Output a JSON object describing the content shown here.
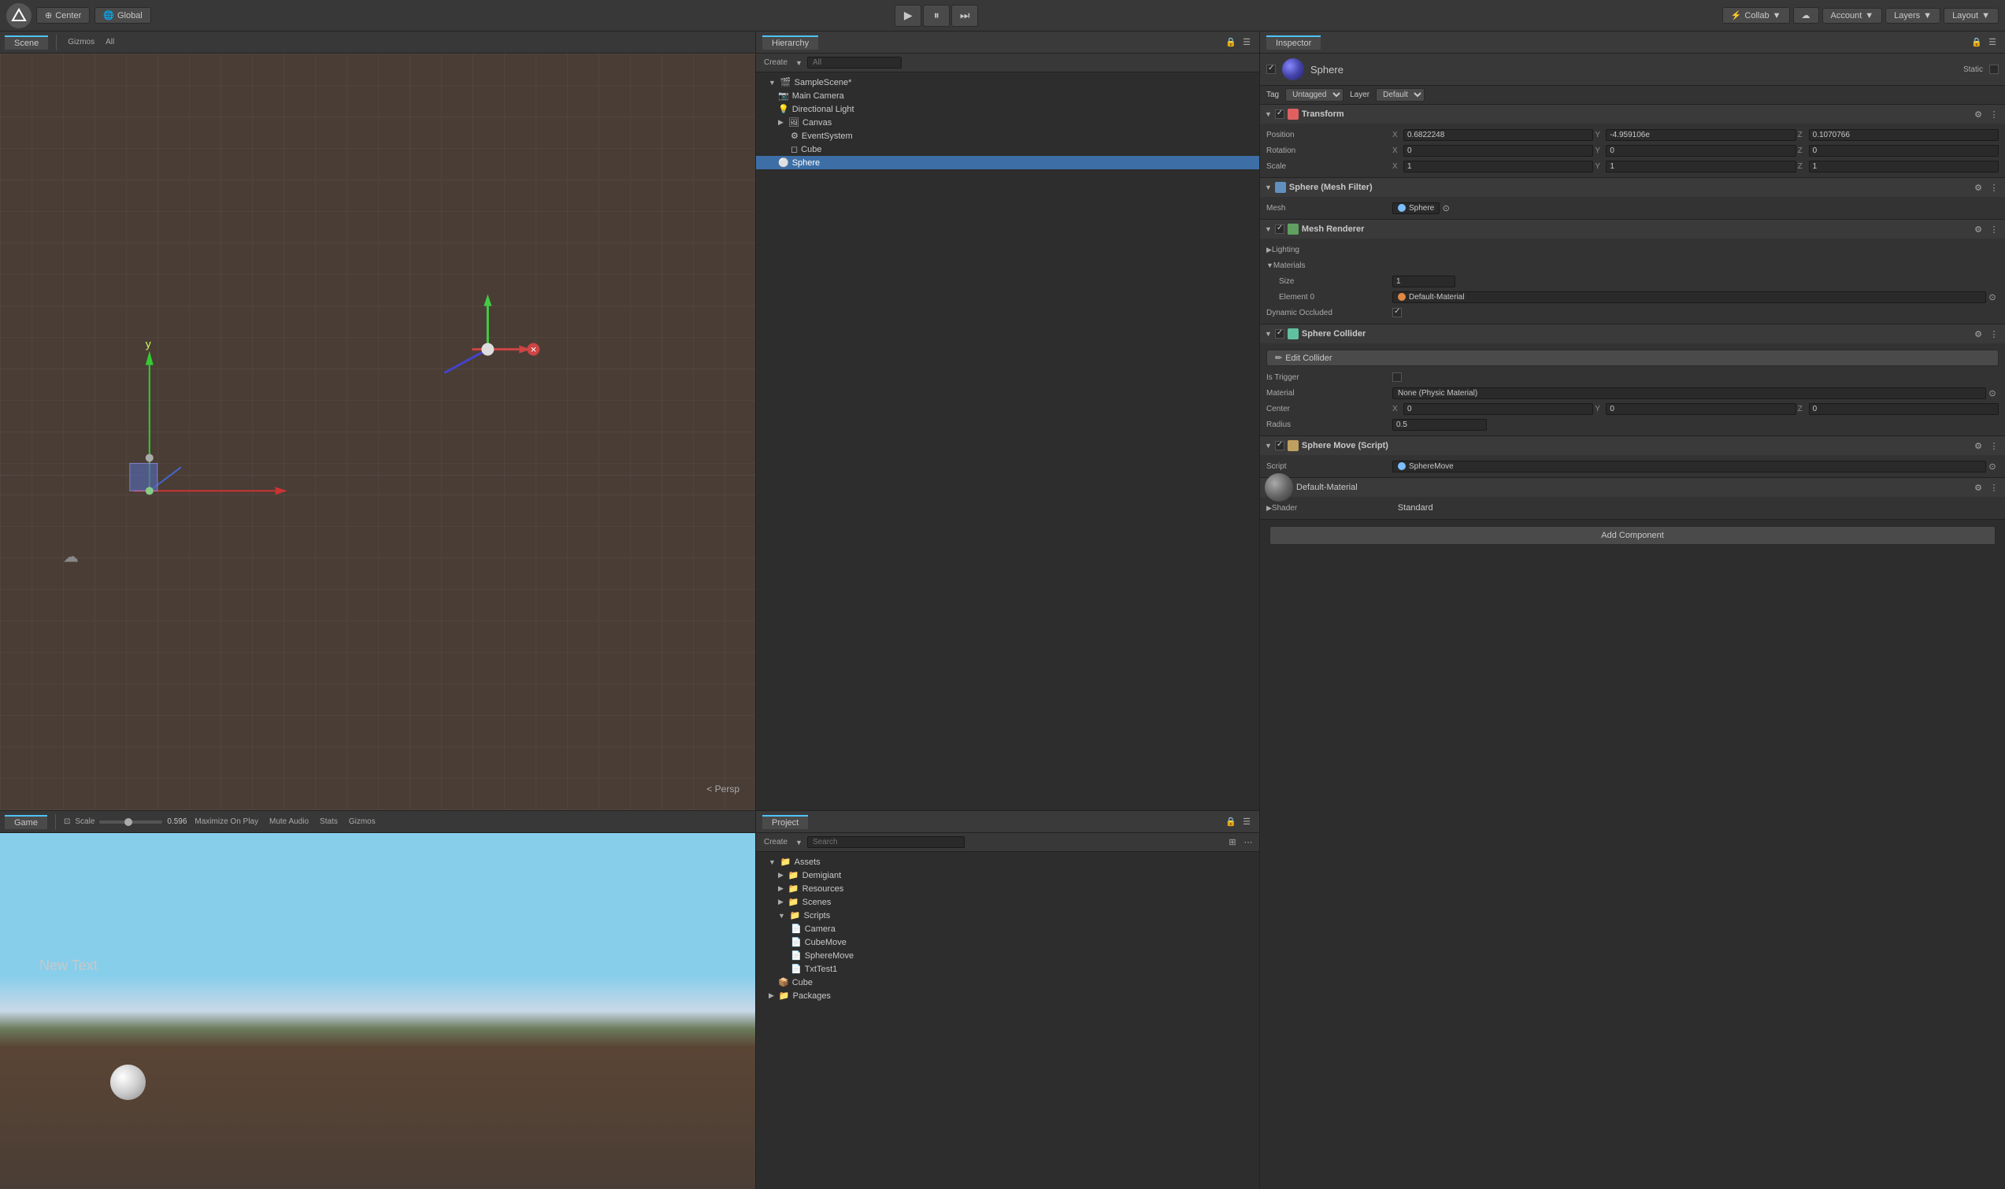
{
  "toolbar": {
    "logo": "U",
    "transform_center": "Center",
    "transform_global": "Global",
    "play": "▶",
    "pause": "⏸",
    "step": "⏭",
    "collab": "Collab",
    "cloud_icon": "☁",
    "account": "Account",
    "layers": "Layers",
    "layout": "Layout"
  },
  "scene": {
    "tab_label": "Scene",
    "gizmos": "Gizmos",
    "all_filter": "All",
    "persp_label": "< Persp"
  },
  "game": {
    "scale_label": "Scale",
    "scale_value": "0.596",
    "maximize_on_play": "Maximize On Play",
    "mute_audio": "Mute Audio",
    "stats": "Stats",
    "gizmos": "Gizmos",
    "new_text": "New Text"
  },
  "hierarchy": {
    "tab_label": "Hierarchy",
    "create_label": "Create",
    "all_label": "All",
    "scene_name": "SampleScene*",
    "items": [
      {
        "name": "Main Camera",
        "indent": 1,
        "type": "camera"
      },
      {
        "name": "Directional Light",
        "indent": 1,
        "type": "light"
      },
      {
        "name": "Canvas",
        "indent": 1,
        "type": "canvas"
      },
      {
        "name": "EventSystem",
        "indent": 2,
        "type": "go"
      },
      {
        "name": "Cube",
        "indent": 2,
        "type": "go"
      },
      {
        "name": "Sphere",
        "indent": 1,
        "type": "go",
        "selected": true
      }
    ]
  },
  "project": {
    "tab_label": "Project",
    "create_label": "Create",
    "search_placeholder": "Search",
    "items": [
      {
        "name": "Assets",
        "indent": 0,
        "type": "folder",
        "expanded": true
      },
      {
        "name": "Demigiant",
        "indent": 1,
        "type": "folder"
      },
      {
        "name": "Resources",
        "indent": 1,
        "type": "folder"
      },
      {
        "name": "Scenes",
        "indent": 1,
        "type": "folder"
      },
      {
        "name": "Scripts",
        "indent": 1,
        "type": "folder",
        "expanded": true
      },
      {
        "name": "Camera",
        "indent": 2,
        "type": "folder"
      },
      {
        "name": "CubeMove",
        "indent": 2,
        "type": "folder"
      },
      {
        "name": "SphereMove",
        "indent": 2,
        "type": "folder"
      },
      {
        "name": "TxtTest1",
        "indent": 2,
        "type": "folder"
      },
      {
        "name": "Cube",
        "indent": 1,
        "type": "script"
      },
      {
        "name": "Packages",
        "indent": 0,
        "type": "folder"
      }
    ]
  },
  "inspector": {
    "tab_label": "Inspector",
    "object_name": "Sphere",
    "static_label": "Static",
    "tag": "Untagged",
    "layer": "Default",
    "transform": {
      "title": "Transform",
      "position": {
        "x": "0.6822248",
        "y": "-4.959106e",
        "z": "0.1070766"
      },
      "rotation": {
        "x": "0",
        "y": "0",
        "z": "0"
      },
      "scale": {
        "x": "1",
        "y": "1",
        "z": "1"
      }
    },
    "mesh_filter": {
      "title": "Sphere (Mesh Filter)",
      "mesh": "Sphere"
    },
    "mesh_renderer": {
      "title": "Mesh Renderer",
      "lighting_label": "Lighting",
      "materials_label": "Materials",
      "size": "1",
      "element0": "Default-Material",
      "dynamic_occluded": "Dynamic Occluded"
    },
    "sphere_collider": {
      "title": "Sphere Collider",
      "edit_collider": "Edit Collider",
      "is_trigger_label": "Is Trigger",
      "material_label": "Material",
      "material_value": "None (Physic Material)",
      "center_label": "Center",
      "center_x": "0",
      "center_y": "0",
      "center_z": "0",
      "radius_label": "Radius",
      "radius_value": "0.5"
    },
    "sphere_move": {
      "title": "Sphere Move (Script)",
      "script_label": "Script",
      "script_value": "SphereMove"
    },
    "default_material": {
      "name": "Default-Material",
      "shader_label": "Shader",
      "shader_value": "Standard"
    },
    "add_component": "Add Component"
  }
}
